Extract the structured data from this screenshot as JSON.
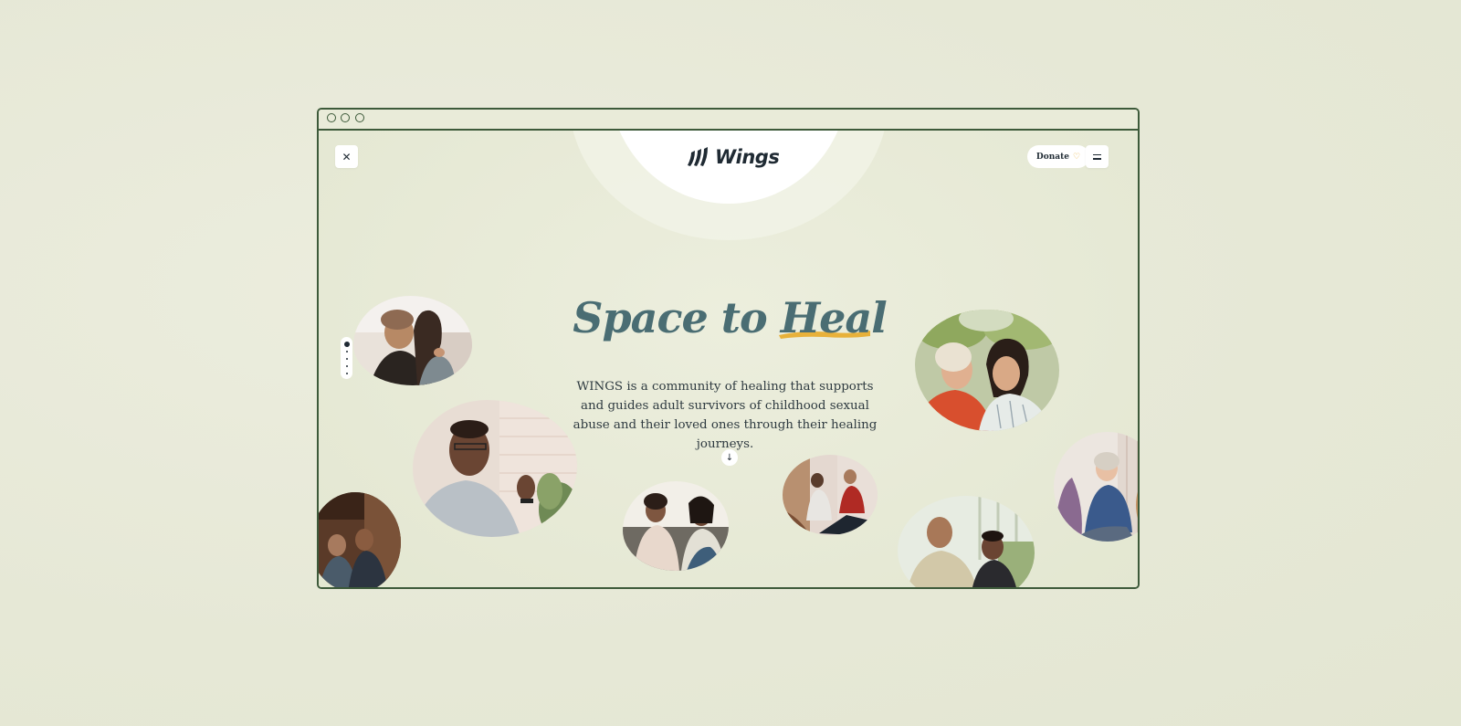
{
  "header": {
    "logo_text": "Wings",
    "donate_label": "Donate"
  },
  "hero": {
    "title_part1": "Space to",
    "title_highlight": "Heal",
    "description": "WINGS is a community of healing that supports and guides adult survivors of childhood sexual abuse and their loved ones through their healing journeys."
  },
  "icons": {
    "close": "close-icon",
    "menu": "menu-icon",
    "heart": "heart-icon",
    "scroll": "arrow-down-icon",
    "logo": "wings-logo-icon"
  },
  "colors": {
    "page_bg": "#e8eadb",
    "frame": "#3d5a3a",
    "headline": "#4a6d73",
    "highlight": "#e8b13a",
    "text": "#2e3a40"
  },
  "carousel": {
    "page_count": 5,
    "active_index": 0
  }
}
